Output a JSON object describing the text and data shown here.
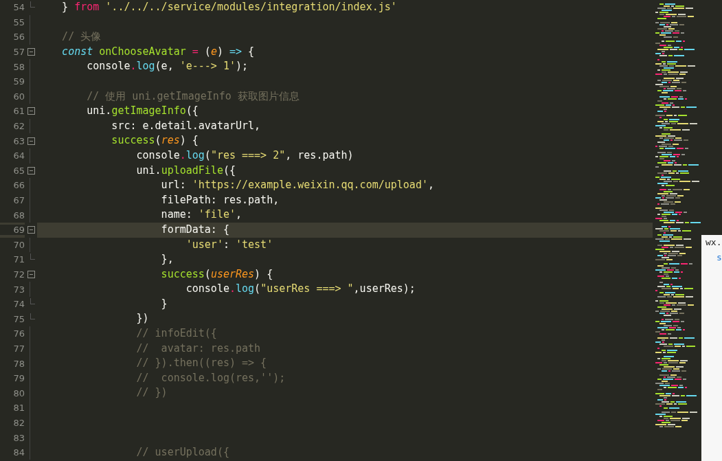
{
  "editor": {
    "lines": [
      {
        "number": "54",
        "collapsible": false,
        "block_end": true,
        "current": false,
        "tokens": [
          {
            "text": "    }",
            "kind": "plain"
          },
          {
            "text": " from",
            "kind": "keyword"
          },
          {
            "text": " '../../../service/modules/integration/index.js'",
            "kind": "string"
          }
        ]
      },
      {
        "number": "55",
        "collapsible": false,
        "block_end": false,
        "current": false
      },
      {
        "number": "56",
        "collapsible": false,
        "block_end": false,
        "current": false,
        "tokens": [
          {
            "text": "    // 头像",
            "kind": "comment"
          }
        ]
      },
      {
        "number": "57",
        "collapsible": true,
        "block_end": false,
        "current": false,
        "tokens": [
          {
            "text": "    const",
            "kind": "storage"
          },
          {
            "text": " onChooseAvatar",
            "kind": "function"
          },
          {
            "text": " =",
            "kind": "keyword"
          },
          {
            "text": " (",
            "kind": "plain"
          },
          {
            "text": "e",
            "kind": "param"
          },
          {
            "text": ") ",
            "kind": "plain"
          },
          {
            "text": "=>",
            "kind": "support"
          },
          {
            "text": " {",
            "kind": "plain"
          }
        ]
      },
      {
        "number": "58",
        "collapsible": false,
        "block_end": false,
        "current": false,
        "tokens": [
          {
            "text": "        console",
            "kind": "plain"
          },
          {
            "text": ".",
            "kind": "keyword"
          },
          {
            "text": "log",
            "kind": "support"
          },
          {
            "text": "(e, ",
            "kind": "plain"
          },
          {
            "text": "'e---> 1'",
            "kind": "string"
          },
          {
            "text": ");",
            "kind": "plain"
          }
        ]
      },
      {
        "number": "59",
        "collapsible": false,
        "block_end": false,
        "current": false
      },
      {
        "number": "60",
        "collapsible": false,
        "block_end": false,
        "current": false,
        "tokens": [
          {
            "text": "        // 使用 uni.getImageInfo 获取图片信息",
            "kind": "comment"
          }
        ]
      },
      {
        "number": "61",
        "collapsible": true,
        "block_end": false,
        "current": false,
        "tokens": [
          {
            "text": "        uni.",
            "kind": "plain"
          },
          {
            "text": "getImageInfo",
            "kind": "function"
          },
          {
            "text": "({",
            "kind": "plain"
          }
        ]
      },
      {
        "number": "62",
        "collapsible": false,
        "block_end": false,
        "current": false,
        "tokens": [
          {
            "text": "            src: e.detail.avatarUrl,",
            "kind": "plain"
          }
        ]
      },
      {
        "number": "63",
        "collapsible": true,
        "block_end": false,
        "current": false,
        "tokens": [
          {
            "text": "            success",
            "kind": "function"
          },
          {
            "text": "(",
            "kind": "plain"
          },
          {
            "text": "res",
            "kind": "param"
          },
          {
            "text": ") {",
            "kind": "plain"
          }
        ]
      },
      {
        "number": "64",
        "collapsible": false,
        "block_end": false,
        "current": false,
        "tokens": [
          {
            "text": "                console",
            "kind": "plain"
          },
          {
            "text": ".",
            "kind": "keyword"
          },
          {
            "text": "log",
            "kind": "support"
          },
          {
            "text": "(",
            "kind": "plain"
          },
          {
            "text": "\"res ===> 2\"",
            "kind": "string"
          },
          {
            "text": ", res.path)",
            "kind": "plain"
          }
        ]
      },
      {
        "number": "65",
        "collapsible": true,
        "block_end": false,
        "current": false,
        "tokens": [
          {
            "text": "                uni.",
            "kind": "plain"
          },
          {
            "text": "uploadFile",
            "kind": "function"
          },
          {
            "text": "({",
            "kind": "plain"
          }
        ]
      },
      {
        "number": "66",
        "collapsible": false,
        "block_end": false,
        "current": false,
        "tokens": [
          {
            "text": "                    url: ",
            "kind": "plain"
          },
          {
            "text": "'https://example.weixin.qq.com/upload'",
            "kind": "string"
          },
          {
            "text": ",",
            "kind": "plain"
          }
        ]
      },
      {
        "number": "67",
        "collapsible": false,
        "block_end": false,
        "current": false,
        "tokens": [
          {
            "text": "                    filePath: res.path,",
            "kind": "plain"
          }
        ]
      },
      {
        "number": "68",
        "collapsible": false,
        "block_end": false,
        "current": false,
        "tokens": [
          {
            "text": "                    name: ",
            "kind": "plain"
          },
          {
            "text": "'file'",
            "kind": "string"
          },
          {
            "text": ",",
            "kind": "plain"
          }
        ]
      },
      {
        "number": "69",
        "collapsible": true,
        "block_end": false,
        "current": true,
        "tokens": [
          {
            "text": "                    formData: {",
            "kind": "plain"
          }
        ]
      },
      {
        "number": "70",
        "collapsible": false,
        "block_end": false,
        "current": false,
        "tokens": [
          {
            "text": "                        'user'",
            "kind": "string"
          },
          {
            "text": ": ",
            "kind": "plain"
          },
          {
            "text": "'test'",
            "kind": "string"
          }
        ]
      },
      {
        "number": "71",
        "collapsible": false,
        "block_end": true,
        "current": false,
        "tokens": [
          {
            "text": "                    },",
            "kind": "plain"
          }
        ]
      },
      {
        "number": "72",
        "collapsible": true,
        "block_end": false,
        "current": false,
        "tokens": [
          {
            "text": "                    success",
            "kind": "function"
          },
          {
            "text": "(",
            "kind": "plain"
          },
          {
            "text": "userRes",
            "kind": "param"
          },
          {
            "text": ") {",
            "kind": "plain"
          }
        ]
      },
      {
        "number": "73",
        "collapsible": false,
        "block_end": false,
        "current": false,
        "tokens": [
          {
            "text": "                        console",
            "kind": "plain"
          },
          {
            "text": ".",
            "kind": "keyword"
          },
          {
            "text": "log",
            "kind": "support"
          },
          {
            "text": "(",
            "kind": "plain"
          },
          {
            "text": "\"userRes ===> \"",
            "kind": "string"
          },
          {
            "text": ",userRes);",
            "kind": "plain"
          }
        ]
      },
      {
        "number": "74",
        "collapsible": false,
        "block_end": true,
        "current": false,
        "tokens": [
          {
            "text": "                    }",
            "kind": "plain"
          }
        ]
      },
      {
        "number": "75",
        "collapsible": false,
        "block_end": true,
        "current": false,
        "tokens": [
          {
            "text": "                })",
            "kind": "plain"
          }
        ]
      },
      {
        "number": "76",
        "collapsible": false,
        "block_end": false,
        "current": false,
        "tokens": [
          {
            "text": "                // infoEdit({",
            "kind": "comment"
          }
        ]
      },
      {
        "number": "77",
        "collapsible": false,
        "block_end": false,
        "current": false,
        "tokens": [
          {
            "text": "                //  avatar: res.path",
            "kind": "comment"
          }
        ]
      },
      {
        "number": "78",
        "collapsible": false,
        "block_end": false,
        "current": false,
        "tokens": [
          {
            "text": "                // }).then((res) => {",
            "kind": "comment"
          }
        ]
      },
      {
        "number": "79",
        "collapsible": false,
        "block_end": false,
        "current": false,
        "tokens": [
          {
            "text": "                //  console.log(res,'');",
            "kind": "comment"
          }
        ]
      },
      {
        "number": "80",
        "collapsible": false,
        "block_end": false,
        "current": false,
        "tokens": [
          {
            "text": "                // })",
            "kind": "comment"
          }
        ]
      },
      {
        "number": "81",
        "collapsible": false,
        "block_end": false,
        "current": false
      },
      {
        "number": "82",
        "collapsible": false,
        "block_end": false,
        "current": false
      },
      {
        "number": "83",
        "collapsible": false,
        "block_end": false,
        "current": false
      },
      {
        "number": "84",
        "collapsible": false,
        "block_end": false,
        "current": false,
        "tokens": [
          {
            "text": "                // userUpload({",
            "kind": "comment"
          }
        ]
      }
    ]
  },
  "autocomplete": {
    "items": [
      {
        "text": "wx.",
        "kind": "typed"
      },
      {
        "text": "s",
        "kind": "suggestion"
      }
    ]
  }
}
